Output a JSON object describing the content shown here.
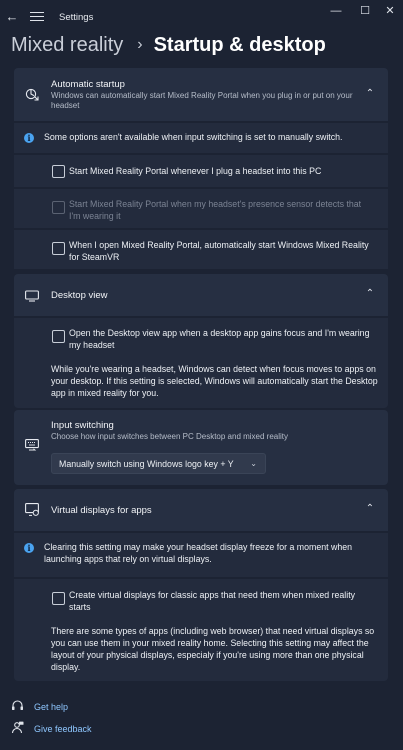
{
  "window": {
    "title": "Settings",
    "minimize": "—",
    "maximize": "☐",
    "close": "✕"
  },
  "breadcrumb": {
    "parent": "Mixed reality",
    "separator": "›",
    "current": "Startup & desktop"
  },
  "automatic_startup": {
    "title": "Automatic startup",
    "description": "Windows can automatically start Mixed Reality Portal when you plug in or put on your headset",
    "info": "Some options aren't available when input switching is set to manually switch.",
    "options": [
      {
        "label": "Start Mixed Reality Portal whenever I plug a headset into this PC",
        "checked": false,
        "enabled": true
      },
      {
        "label": "Start Mixed Reality Portal when my headset's presence sensor detects that I'm wearing it",
        "checked": false,
        "enabled": false
      },
      {
        "label": "When I open Mixed Reality Portal, automatically start Windows Mixed Reality for SteamVR",
        "checked": false,
        "enabled": true
      }
    ]
  },
  "desktop_view": {
    "title": "Desktop view",
    "option": {
      "label": "Open the Desktop view app when a desktop app gains focus and I'm wearing my headset",
      "checked": false
    },
    "paragraph": "While you're wearing a headset, Windows can detect when focus moves to apps on your desktop. If this setting is selected, Windows will automatically start the Desktop app in mixed reality for you."
  },
  "input_switching": {
    "title": "Input switching",
    "description": "Choose how input switches between PC Desktop and mixed reality",
    "selected": "Manually switch using Windows logo key + Y"
  },
  "virtual_displays": {
    "title": "Virtual displays for apps",
    "info": "Clearing this setting may make your headset display freeze for a moment when launching apps that rely on virtual displays.",
    "option": {
      "label": "Create virtual displays for classic apps that need them when mixed reality starts",
      "checked": false
    },
    "paragraph": "There are some types of apps (including web browser) that need virtual displays so you can use them in your mixed reality home. Selecting this setting may affect the layout of your physical displays, especialy if you're using more than one physical display."
  },
  "links": {
    "help": "Get help",
    "feedback": "Give feedback"
  },
  "colors": {
    "background": "#1c2333",
    "card": "#262f42",
    "accent": "#4aa3f0",
    "link": "#8fc7ff"
  }
}
